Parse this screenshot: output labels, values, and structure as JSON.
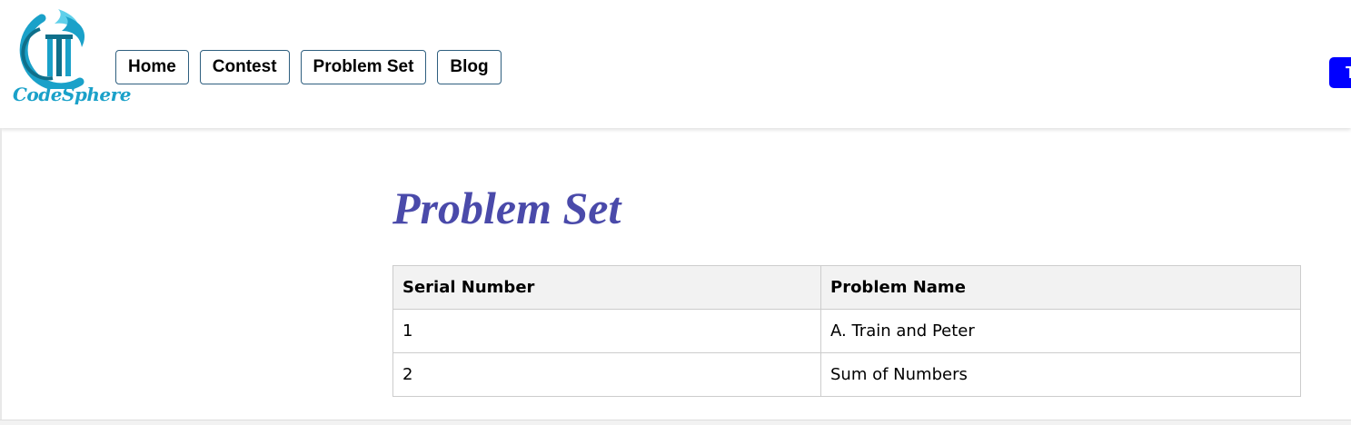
{
  "brand": {
    "name": "CodeSphere",
    "colors": {
      "primary": "#1aa1c9",
      "dark": "#0f6f8a",
      "light": "#5fd0ea"
    }
  },
  "nav": {
    "items": [
      {
        "label": "Home"
      },
      {
        "label": "Contest"
      },
      {
        "label": "Problem Set"
      },
      {
        "label": "Blog"
      }
    ]
  },
  "side_button": {
    "label": "T",
    "color": "#0000ff"
  },
  "main": {
    "title": "Problem Set",
    "title_color": "#4a4aaa",
    "table": {
      "headers": [
        "Serial Number",
        "Problem Name"
      ],
      "rows": [
        [
          "1",
          "A. Train and Peter"
        ],
        [
          "2",
          "Sum of Numbers"
        ]
      ]
    }
  }
}
